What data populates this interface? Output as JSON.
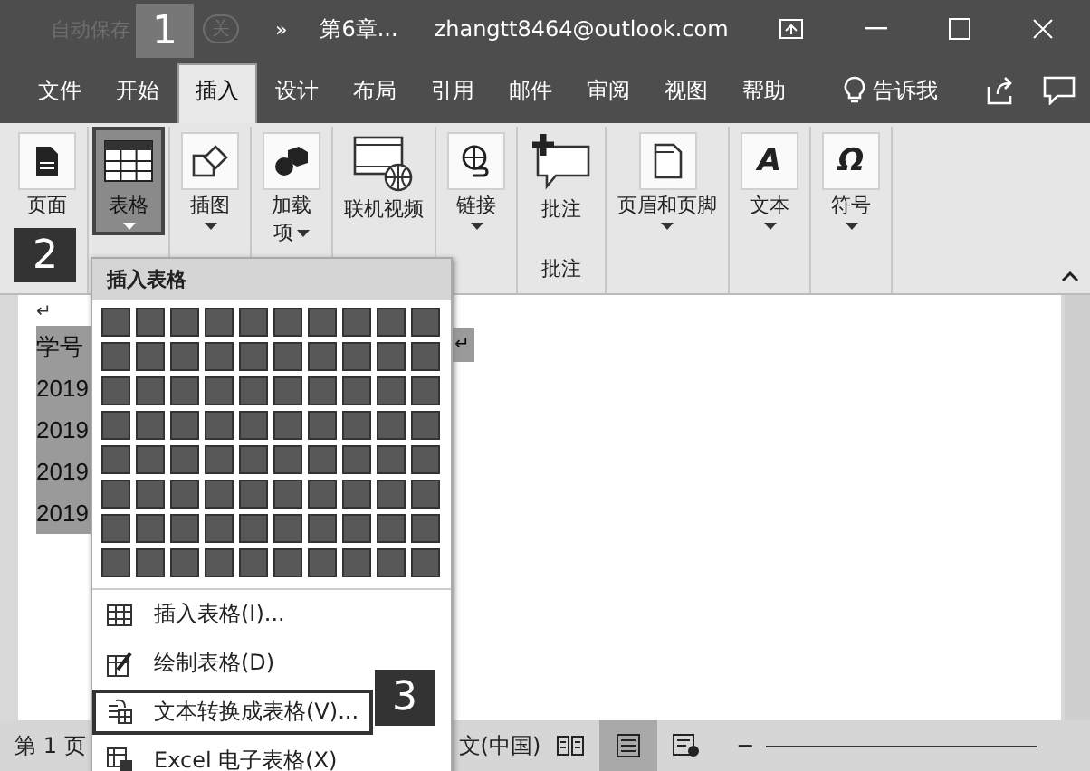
{
  "title_bar": {
    "autosave_label": "自动保存",
    "autosave_state": "关",
    "overflow": "»",
    "document": "第6章...",
    "account": "zhangtt8464@outlook.com"
  },
  "tabs": [
    {
      "label": "文件",
      "selected": false
    },
    {
      "label": "开始",
      "selected": false
    },
    {
      "label": "插入",
      "selected": true
    },
    {
      "label": "设计",
      "selected": false
    },
    {
      "label": "布局",
      "selected": false
    },
    {
      "label": "引用",
      "selected": false
    },
    {
      "label": "邮件",
      "selected": false
    },
    {
      "label": "审阅",
      "selected": false
    },
    {
      "label": "视图",
      "selected": false
    },
    {
      "label": "帮助",
      "selected": false
    }
  ],
  "tell_me": "告诉我",
  "ribbon": [
    {
      "kind": "page",
      "label": "页面",
      "dropdown": false,
      "selected": false
    },
    {
      "kind": "table",
      "label": "表格",
      "dropdown": true,
      "selected": true
    },
    {
      "kind": "shapes",
      "label": "插图",
      "dropdown": true,
      "selected": false
    },
    {
      "kind": "addin",
      "label": "加载",
      "label_2": "项",
      "dropdown": true,
      "selected": false
    },
    {
      "kind": "video",
      "label": "联机视频",
      "dropdown": false,
      "selected": false
    },
    {
      "kind": "link",
      "label": "链接",
      "dropdown": true,
      "selected": false
    },
    {
      "kind": "comment",
      "label": "批注",
      "dropdown": false,
      "selected": false,
      "group": "批注"
    },
    {
      "kind": "header",
      "label": "页眉和页脚",
      "dropdown": true,
      "selected": false
    },
    {
      "kind": "glyph",
      "glyph": "A",
      "label": "文本",
      "dropdown": true,
      "selected": false
    },
    {
      "kind": "glyph",
      "glyph": "Ω",
      "label": "符号",
      "dropdown": true,
      "selected": false
    }
  ],
  "document": {
    "mark": "↵",
    "lines": [
      "学号",
      "2019",
      "2019",
      "2019",
      "2019"
    ],
    "right_mark": "↵"
  },
  "menu": {
    "header": "插入表格",
    "items": [
      {
        "kind": "insert",
        "label": "插入表格(I)...",
        "selected": false
      },
      {
        "kind": "draw",
        "label": "绘制表格(D)",
        "selected": false
      },
      {
        "kind": "convert",
        "label": "文本转换成表格(V)...",
        "selected": true
      },
      {
        "kind": "excel",
        "label": "Excel 电子表格(X)",
        "selected": false
      }
    ]
  },
  "status_bar": {
    "page": "第 1 页",
    "language": "文(中国)",
    "views": [
      {
        "kind": "read",
        "selected": false
      },
      {
        "kind": "print",
        "selected": true
      },
      {
        "kind": "web",
        "selected": false
      }
    ],
    "zoom_out": "−"
  },
  "callouts": [
    "1",
    "2",
    "3"
  ]
}
